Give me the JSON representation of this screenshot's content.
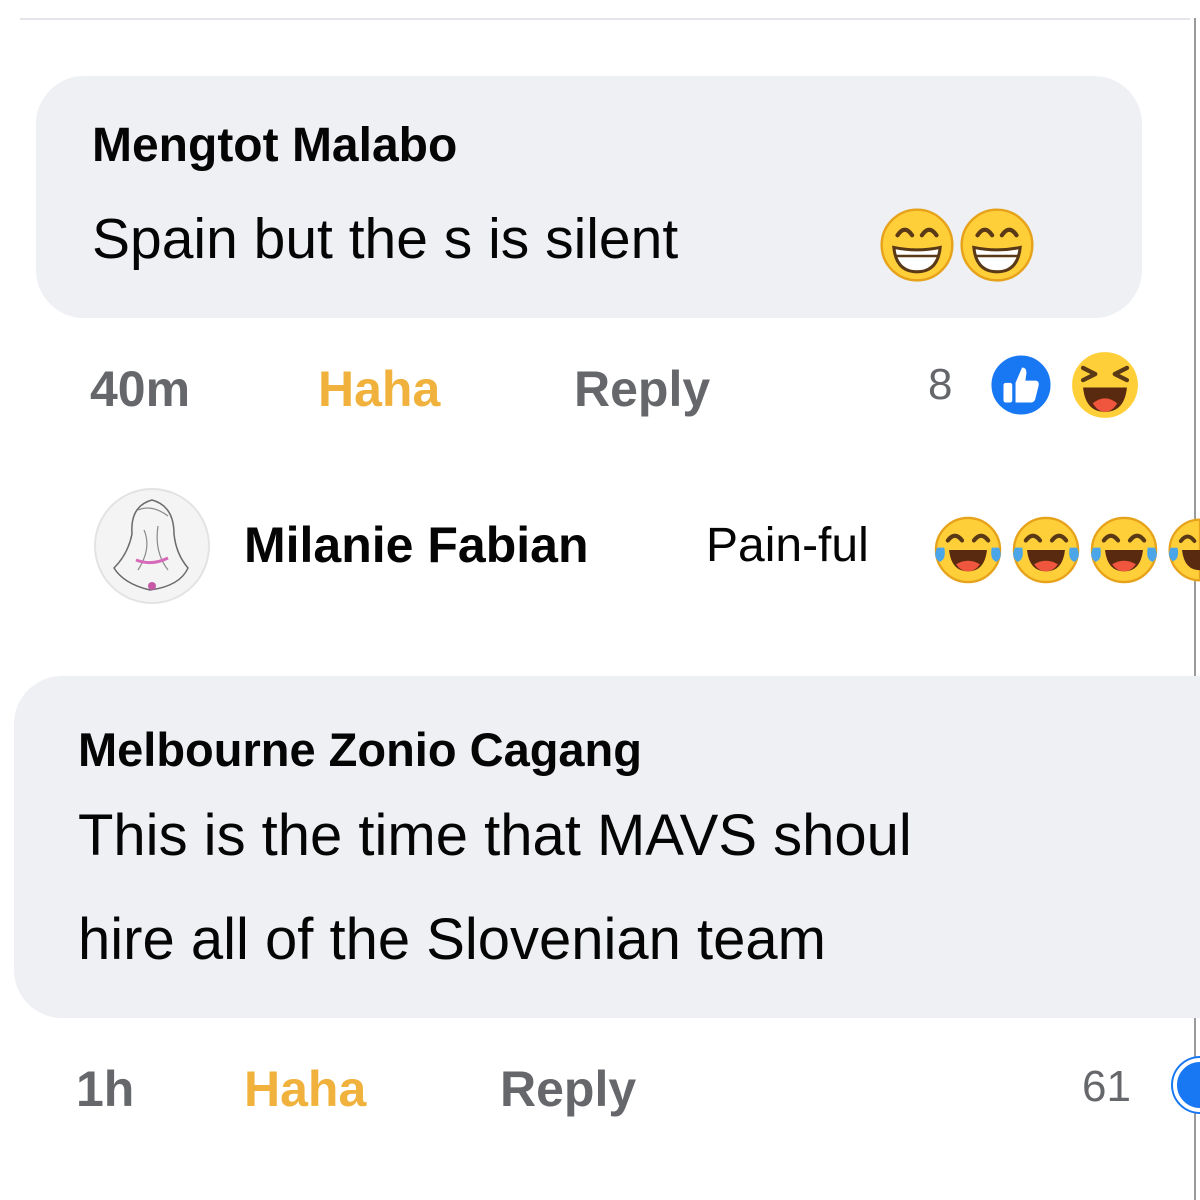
{
  "comments": [
    {
      "author": "Mengtot Malabo",
      "text": "Spain but the s is silent",
      "text_emojis": [
        "grinning-face-with-smiling-eyes",
        "grinning-face-with-smiling-eyes"
      ],
      "time": "40m",
      "reaction_label": "Haha",
      "reply_label": "Reply",
      "reaction_count": "8",
      "reaction_icons": [
        "like-icon",
        "haha-icon"
      ]
    },
    {
      "author": "Melbourne Zonio Cagang",
      "text_line1": "This is the time that MAVS shoul",
      "text_line2": "hire all of the Slovenian team",
      "time": "1h",
      "reaction_label": "Haha",
      "reply_label": "Reply",
      "reaction_count": "61"
    }
  ],
  "reply": {
    "author": "Milanie Fabian",
    "text": "Pain-ful",
    "text_emojis": [
      "tears-of-joy",
      "tears-of-joy",
      "tears-of-joy",
      "tears-of-joy"
    ]
  },
  "colors": {
    "bubble_bg": "#eef0f4",
    "haha_active": "#f0b23c",
    "meta_gray": "#65676b",
    "like_blue": "#1877f2"
  }
}
